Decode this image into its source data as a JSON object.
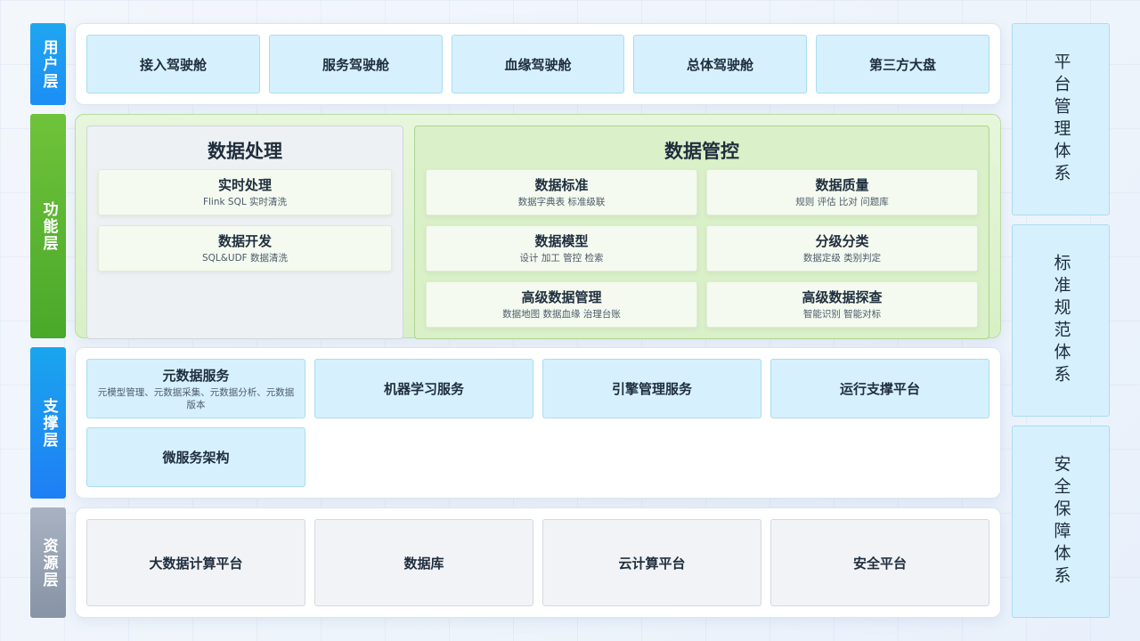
{
  "layers": {
    "user": "用户层",
    "function": "功能层",
    "support": "支撑层",
    "resource": "资源层"
  },
  "user_layer": {
    "items": [
      "接入驾驶舱",
      "服务驾驶舱",
      "血缘驾驶舱",
      "总体驾驶舱",
      "第三方大盘"
    ]
  },
  "function_layer": {
    "processing": {
      "title": "数据处理",
      "cards": [
        {
          "title": "实时处理",
          "sub": "Flink SQL 实时清洗"
        },
        {
          "title": "数据开发",
          "sub": "SQL&UDF 数据清洗"
        }
      ]
    },
    "governance": {
      "title": "数据管控",
      "cards": [
        {
          "title": "数据标准",
          "sub": "数据字典表 标准级联"
        },
        {
          "title": "数据质量",
          "sub": "规则 评估 比对 问题库"
        },
        {
          "title": "数据模型",
          "sub": "设计 加工 管控 检索"
        },
        {
          "title": "分级分类",
          "sub": "数据定级 类别判定"
        },
        {
          "title": "高级数据管理",
          "sub": "数据地图 数据血缘 治理台账"
        },
        {
          "title": "高级数据探查",
          "sub": "智能识别 智能对标"
        }
      ]
    }
  },
  "support_layer": {
    "items": [
      {
        "title": "元数据服务",
        "sub": "元模型管理、元数据采集、元数据分析、元数据版本"
      },
      {
        "title": "机器学习服务",
        "sub": ""
      },
      {
        "title": "引擎管理服务",
        "sub": ""
      },
      {
        "title": "运行支撑平台",
        "sub": ""
      },
      {
        "title": "微服务架构",
        "sub": ""
      }
    ]
  },
  "resource_layer": {
    "items": [
      "大数据计算平台",
      "数据库",
      "云计算平台",
      "安全平台"
    ]
  },
  "right_column": [
    "平台管理体系",
    "标准规范体系",
    "安全保障体系"
  ],
  "colors": {
    "user_label": "#1c8ef5",
    "function_label": "#4aa82a",
    "support_label": "#1e7ff5",
    "resource_label": "#8793a6",
    "cell_blue": "#d6f1fd",
    "cell_grey": "#f1f3f6",
    "function_panel": "#d8f0c6"
  }
}
